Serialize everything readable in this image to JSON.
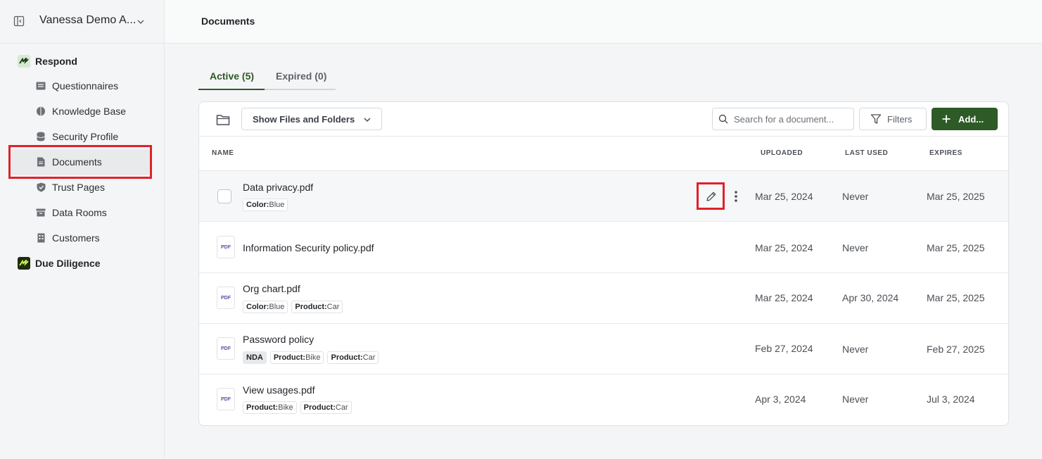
{
  "workspace": {
    "name": "Vanessa Demo A..."
  },
  "sidebar": {
    "sections": [
      {
        "label": "Respond"
      },
      {
        "label": "Due Diligence"
      }
    ],
    "items": [
      {
        "label": "Questionnaires",
        "icon": "list-icon"
      },
      {
        "label": "Knowledge Base",
        "icon": "brain-icon"
      },
      {
        "label": "Security Profile",
        "icon": "database-icon"
      },
      {
        "label": "Documents",
        "icon": "document-icon"
      },
      {
        "label": "Trust Pages",
        "icon": "shield-icon"
      },
      {
        "label": "Data Rooms",
        "icon": "archive-icon"
      },
      {
        "label": "Customers",
        "icon": "building-icon"
      }
    ]
  },
  "header": {
    "title": "Documents"
  },
  "tabs": [
    {
      "label": "Active (5)"
    },
    {
      "label": "Expired (0)"
    }
  ],
  "toolbar": {
    "view_select": "Show Files and Folders",
    "search_placeholder": "Search for a document...",
    "filters_label": "Filters",
    "add_label": "Add..."
  },
  "table": {
    "columns": [
      "NAME",
      "UPLOADED",
      "LAST USED",
      "EXPIRES"
    ],
    "rows": [
      {
        "name": "Data privacy.pdf",
        "uploaded": "Mar 25, 2024",
        "last_used": "Never",
        "expires": "Mar 25, 2025",
        "tags": [
          {
            "key": "Color:",
            "value": "Blue"
          }
        ]
      },
      {
        "name": "Information Security policy.pdf",
        "uploaded": "Mar 25, 2024",
        "last_used": "Never",
        "expires": "Mar 25, 2025",
        "tags": []
      },
      {
        "name": "Org chart.pdf",
        "uploaded": "Mar 25, 2024",
        "last_used": "Apr 30, 2024",
        "expires": "Mar 25, 2025",
        "tags": [
          {
            "key": "Color:",
            "value": "Blue"
          },
          {
            "key": "Product:",
            "value": "Car"
          }
        ]
      },
      {
        "name": "Password policy",
        "uploaded": "Feb 27, 2024",
        "last_used": "Never",
        "expires": "Feb 27, 2025",
        "tags": [
          {
            "key": "NDA",
            "value": ""
          },
          {
            "key": "Product:",
            "value": "Bike"
          },
          {
            "key": "Product:",
            "value": "Car"
          }
        ]
      },
      {
        "name": "View usages.pdf",
        "uploaded": "Apr 3, 2024",
        "last_used": "Never",
        "expires": "Jul 3, 2024",
        "tags": [
          {
            "key": "Product:",
            "value": "Bike"
          },
          {
            "key": "Product:",
            "value": "Car"
          }
        ]
      }
    ],
    "file_badge": "PDF"
  },
  "colors": {
    "accent": "#2d5a27",
    "highlight": "#e0212b"
  }
}
